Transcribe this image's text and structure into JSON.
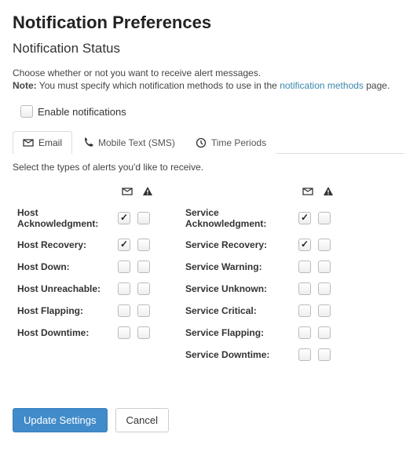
{
  "title": "Notification Preferences",
  "subtitle": "Notification Status",
  "intro_line1": "Choose whether or not you want to receive alert messages.",
  "intro_note_label": "Note:",
  "intro_note_before": " You must specify which notification methods to use in the ",
  "intro_note_link": "notification methods",
  "intro_note_after": " page.",
  "enable_label": "Enable notifications",
  "enable_checked": false,
  "tabs": {
    "email": "Email",
    "sms": "Mobile Text (SMS)",
    "periods": "Time Periods"
  },
  "help_text": "Select the types of alerts you'd like to receive.",
  "left_rows": [
    {
      "label": "Host Acknowledgment:",
      "email": true,
      "alert": false
    },
    {
      "label": "Host Recovery:",
      "email": true,
      "alert": false
    },
    {
      "label": "Host Down:",
      "email": false,
      "alert": false
    },
    {
      "label": "Host Unreachable:",
      "email": false,
      "alert": false
    },
    {
      "label": "Host Flapping:",
      "email": false,
      "alert": false
    },
    {
      "label": "Host Downtime:",
      "email": false,
      "alert": false
    }
  ],
  "right_rows": [
    {
      "label": "Service Acknowledgment:",
      "email": true,
      "alert": false
    },
    {
      "label": "Service Recovery:",
      "email": true,
      "alert": false
    },
    {
      "label": "Service Warning:",
      "email": false,
      "alert": false
    },
    {
      "label": "Service Unknown:",
      "email": false,
      "alert": false
    },
    {
      "label": "Service Critical:",
      "email": false,
      "alert": false
    },
    {
      "label": "Service Flapping:",
      "email": false,
      "alert": false
    },
    {
      "label": "Service Downtime:",
      "email": false,
      "alert": false
    }
  ],
  "buttons": {
    "update": "Update Settings",
    "cancel": "Cancel"
  },
  "icons": {
    "envelope": "envelope-icon",
    "warning": "warning-icon",
    "phone": "phone-icon",
    "clock": "clock-icon"
  }
}
